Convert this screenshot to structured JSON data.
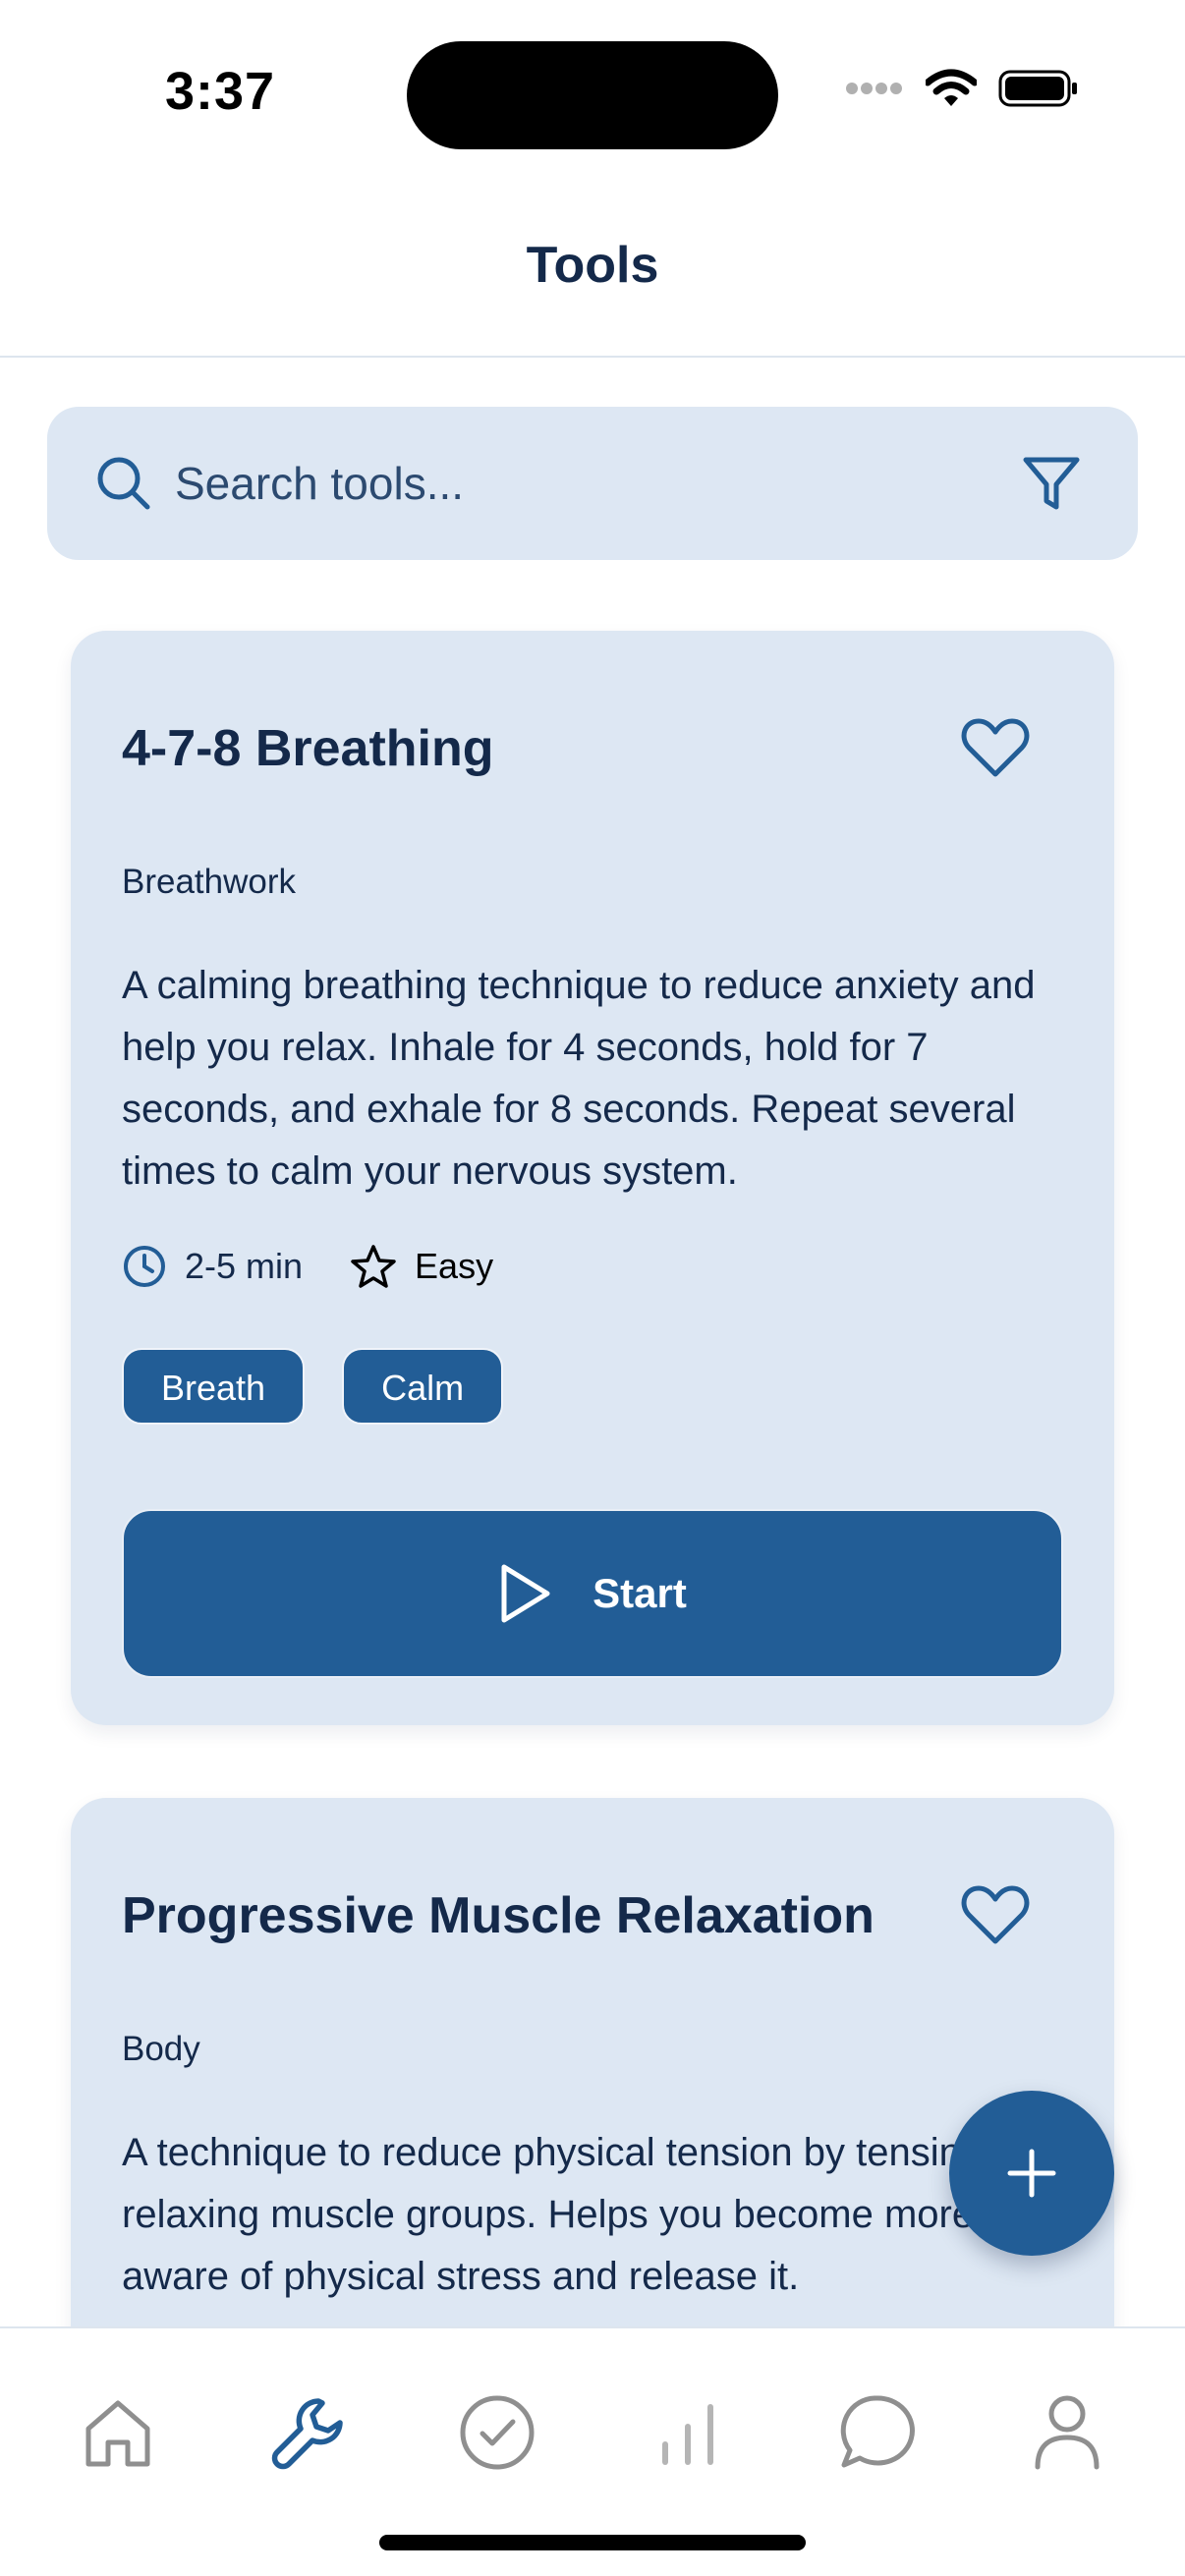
{
  "status_bar": {
    "time": "3:37"
  },
  "header": {
    "title": "Tools"
  },
  "search": {
    "placeholder": "Search tools..."
  },
  "cards": [
    {
      "title": "4-7-8 Breathing",
      "category": "Breathwork",
      "description": "A calming breathing technique to reduce anxiety and help you relax. Inhale for 4 seconds, hold for 7 seconds, and exhale for 8 seconds. Repeat several times to calm your nervous system.",
      "duration": "2-5 min",
      "difficulty": "Easy",
      "tags": [
        "Breath",
        "Calm"
      ],
      "start_label": "Start"
    },
    {
      "title": "Progressive Muscle Relaxation",
      "category": "Body",
      "description": "A technique to reduce physical tension by tensing and relaxing muscle groups. Helps you become more aware of physical stress and release it."
    }
  ],
  "tab_bar": {
    "items": [
      {
        "icon": "home-icon",
        "active": false
      },
      {
        "icon": "wrench-icon",
        "active": true
      },
      {
        "icon": "check-circle-icon",
        "active": false
      },
      {
        "icon": "bar-chart-icon",
        "active": false
      },
      {
        "icon": "chat-bubble-icon",
        "active": false
      },
      {
        "icon": "profile-icon",
        "active": false
      }
    ]
  },
  "colors": {
    "primary": "#225d96",
    "card_bg": "#dde7f3",
    "text": "#14294a",
    "inactive_icon": "#8f8f8f"
  }
}
